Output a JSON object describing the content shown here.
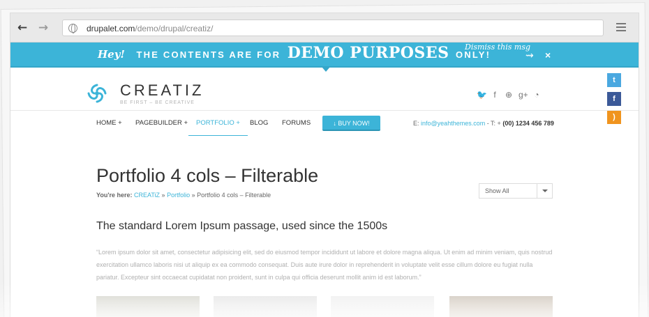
{
  "browser": {
    "url_host": "drupalet.com",
    "url_path": "/demo/drupal/creatiz/",
    "icons": [
      "back-arrow-icon",
      "forward-arrow-icon",
      "globe-icon",
      "menu-icon"
    ]
  },
  "banner": {
    "hey": "Hey!",
    "text_before": "THE CONTENTS ARE FOR",
    "demo": "DEMO PURPOSES",
    "text_after": "ONLY!",
    "dismiss": "Dismiss this msg",
    "color": "#3cb4d8"
  },
  "header": {
    "logo": "CREATIZ",
    "tagline": "BE FIRST – BE CREATIVE",
    "social_icons": [
      "twitter-icon",
      "facebook-icon",
      "dribbble-icon",
      "googleplus-icon",
      "rss-icon"
    ],
    "social_glyphs": [
      "🐦",
      "f",
      "⊕",
      "g+",
      "◔"
    ]
  },
  "share": {
    "twitter": "t",
    "facebook": "f",
    "rss": ")"
  },
  "nav": {
    "items": [
      {
        "label": "HOME +"
      },
      {
        "label": "PAGEBUILDER +"
      },
      {
        "label": "PORTFOLIO +"
      },
      {
        "label": "BLOG"
      },
      {
        "label": "FORUMS"
      }
    ],
    "buy": "↓ BUY NOW!",
    "contact_email_label": "E:",
    "contact_email": "info@yeahthemes.com",
    "contact_phone_label": " - T: +",
    "contact_phone": "(00) 1234 456 789"
  },
  "content": {
    "title": "Portfolio 4 cols – Filterable",
    "breadcrumb_label": "You're here:",
    "crumb1": "CREATiZ",
    "sep": "»",
    "crumb2": "Portfolio",
    "crumb3": "Portfolio 4 cols – Filterable",
    "filter_value": "Show All",
    "subtitle": "The standard Lorem Ipsum passage, used since the 1500s",
    "quote": "“Lorem ipsum dolor sit amet, consectetur adipisicing elit, sed do eiusmod tempor incididunt ut labore et dolore magna aliqua. Ut enim ad minim veniam, quis nostrud exercitation ullamco laboris nisi ut aliquip ex ea commodo consequat. Duis aute irure dolor in reprehenderit in voluptate velit esse cillum dolore eu fugiat nulla pariatur. Excepteur sint occaecat cupidatat non proident, sunt in culpa qui officia deserunt mollit anim id est laborum.”"
  }
}
